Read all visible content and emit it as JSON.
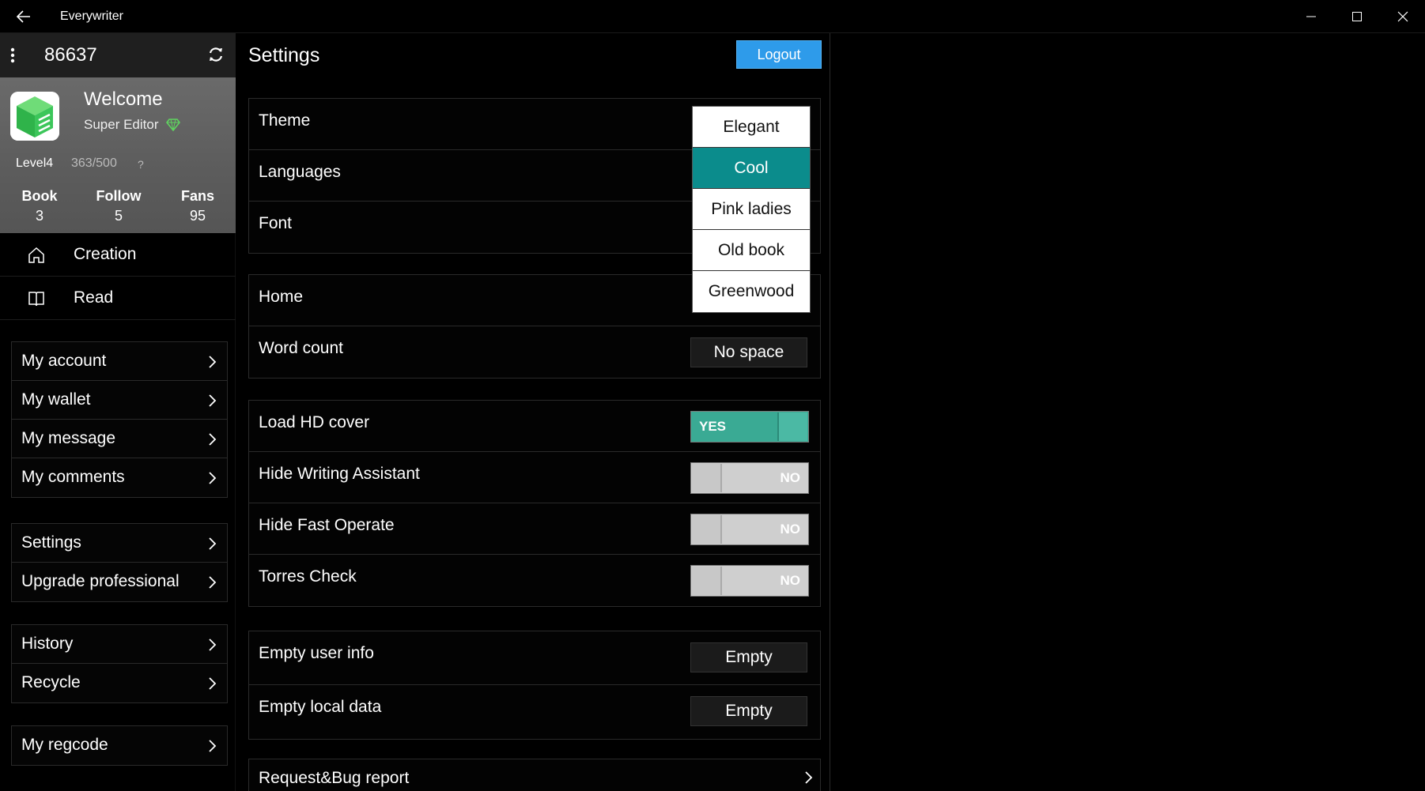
{
  "window": {
    "title": "Everywriter"
  },
  "sidebar": {
    "user_id": "86637",
    "profile": {
      "welcome": "Welcome",
      "role": "Super Editor",
      "level": "Level4",
      "exp": "363/500",
      "help": "?",
      "stats": [
        {
          "label": "Book",
          "value": "3"
        },
        {
          "label": "Follow",
          "value": "5"
        },
        {
          "label": "Fans",
          "value": "95"
        }
      ]
    },
    "nav": [
      {
        "label": "Creation",
        "icon": "home-icon"
      },
      {
        "label": "Read",
        "icon": "book-icon"
      }
    ],
    "groups": [
      [
        "My account",
        "My wallet",
        "My message",
        "My comments"
      ],
      [
        "Settings",
        "Upgrade professional"
      ],
      [
        "History",
        "Recycle"
      ],
      [
        "My regcode"
      ]
    ]
  },
  "settings": {
    "title": "Settings",
    "logout_label": "Logout",
    "general": [
      {
        "label": "Theme"
      },
      {
        "label": "Languages"
      },
      {
        "label": "Font"
      }
    ],
    "display": [
      {
        "label": "Home"
      },
      {
        "label": "Word count",
        "value": "No space"
      }
    ],
    "toggles": [
      {
        "label": "Load HD cover",
        "state": "YES",
        "on": true
      },
      {
        "label": "Hide Writing Assistant",
        "state": "NO",
        "on": false
      },
      {
        "label": "Hide Fast Operate",
        "state": "NO",
        "on": false
      },
      {
        "label": "Torres Check",
        "state": "NO",
        "on": false
      }
    ],
    "data": [
      {
        "label": "Empty user info",
        "button": "Empty"
      },
      {
        "label": "Empty local data",
        "button": "Empty"
      }
    ],
    "report": {
      "label": "Request&Bug report"
    }
  },
  "theme_dropdown": {
    "options": [
      "Elegant",
      "Cool",
      "Pink ladies",
      "Old book",
      "Greenwood"
    ],
    "selected": "Cool"
  },
  "colors": {
    "accent": "#2e9bea",
    "toggle_on": "#3aaa94",
    "selected_option": "#0b8c8c"
  }
}
